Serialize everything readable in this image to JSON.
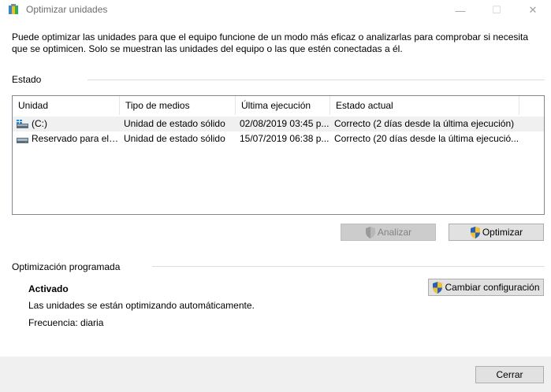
{
  "window": {
    "title": "Optimizar unidades",
    "min_glyph": "—",
    "max_glyph": "☐",
    "close_glyph": "✕"
  },
  "description": "Puede optimizar las unidades para que el equipo funcione de un modo más eficaz o analizarlas para comprobar si necesita que se optimicen. Solo se muestran las unidades del equipo o las que estén conectadas a él.",
  "status_section": {
    "label": "Estado",
    "columns": [
      "Unidad",
      "Tipo de medios",
      "Última ejecución",
      "Estado actual"
    ],
    "rows": [
      {
        "drive": "(C:)",
        "media_type": "Unidad de estado sólido",
        "last_run": "02/08/2019 03:45 p...",
        "status": "Correcto (2 días desde la última ejecución)",
        "icon": "windows-drive-icon",
        "selected": true
      },
      {
        "drive": "Reservado para el s...",
        "media_type": "Unidad de estado sólido",
        "last_run": "15/07/2019 06:38 p...",
        "status": "Correcto (20 días desde la última ejecució...",
        "icon": "drive-icon",
        "selected": false
      }
    ]
  },
  "buttons": {
    "analyze": "Analizar",
    "optimize": "Optimizar",
    "change_settings": "Cambiar configuración",
    "close": "Cerrar"
  },
  "scheduled": {
    "label": "Optimización programada",
    "state": "Activado",
    "message": "Las unidades se están optimizando automáticamente.",
    "frequency": "Frecuencia: diaria"
  },
  "colors": {
    "selected_row": "#f0f0f0",
    "button_face": "#e1e1e1",
    "disabled_button": "#cccccc",
    "footer": "#f0f0f0"
  }
}
